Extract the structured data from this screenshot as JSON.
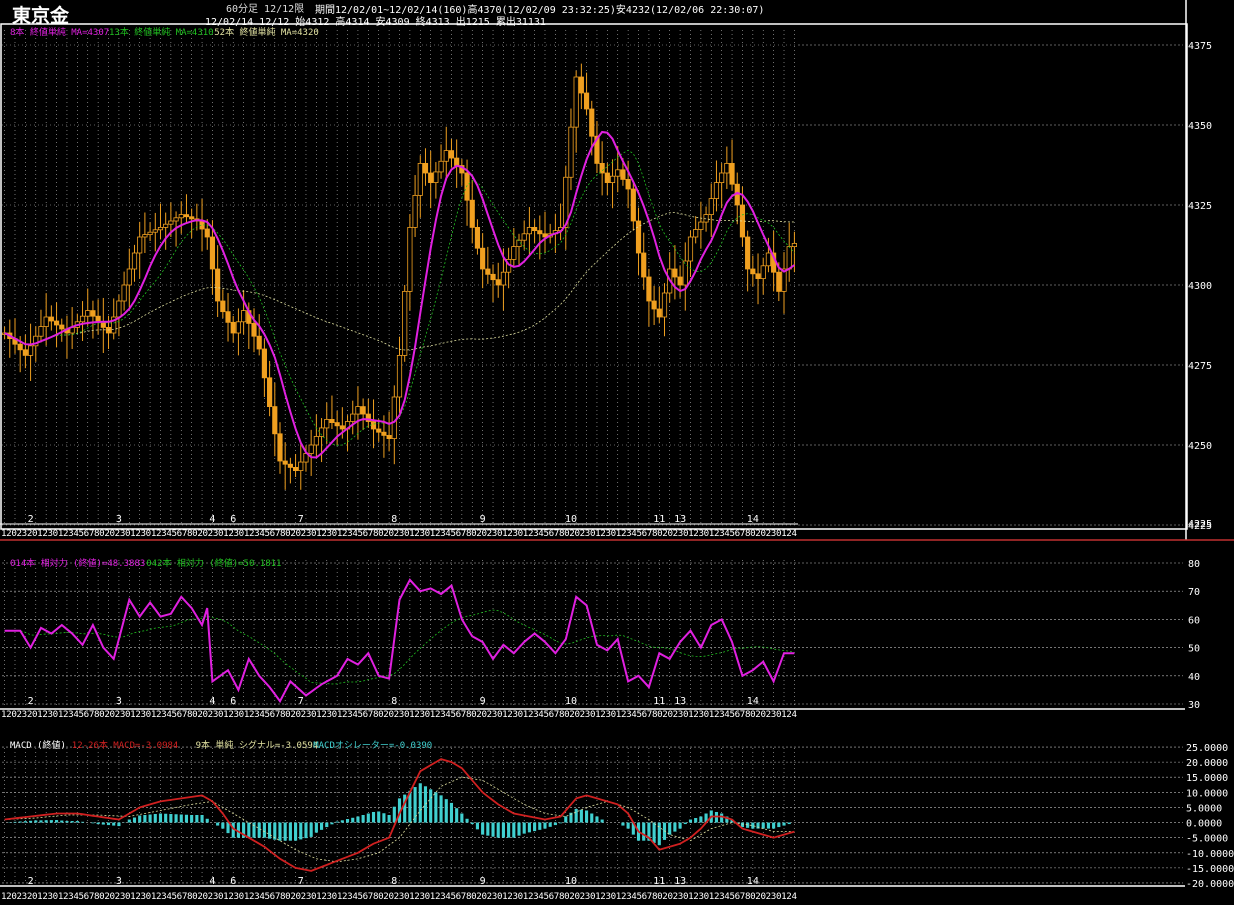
{
  "header": {
    "title": "東京金",
    "period_label": "60分足 12/12限",
    "range_line": "期間12/02/01~12/02/14(160)高4370(12/02/09 23:32:25)安4232(12/02/06 22:30:07)",
    "ohlc_line": "12/02/14 12/12 始4312 高4314 安4309 終4313 出1215 累出31131"
  },
  "colors": {
    "background": "#000000",
    "up_candle": "#f0a020",
    "ma_fast": "#e020e0",
    "ma_mid": "#20c020",
    "ma_slow": "#e0e0a0",
    "macd_line": "#d02020",
    "signal_line": "#e0e0a0",
    "histogram": "#40d0d0",
    "frame": "#ffffff",
    "separator": "#c03030"
  },
  "chart_data": [
    {
      "type": "candlestick",
      "panel": "price",
      "legend": [
        {
          "label": "8本 終値単純 MA=4307",
          "color": "#e020e0"
        },
        {
          "label": "13本 終値単純 MA=4310",
          "color": "#20c020"
        },
        {
          "label": "52本 終値単純 MA=4320",
          "color": "#e0e0a0"
        }
      ],
      "ylim": [
        4225,
        4380
      ],
      "yticks": [
        "4375",
        "4350",
        "4325",
        "4300",
        "4275",
        "4250",
        "4225"
      ],
      "xtick_days": [
        {
          "label": "2",
          "bar": 5
        },
        {
          "label": "3",
          "bar": 22
        },
        {
          "label": "4",
          "bar": 40
        },
        {
          "label": "6",
          "bar": 44
        },
        {
          "label": "7",
          "bar": 57
        },
        {
          "label": "8",
          "bar": 75
        },
        {
          "label": "9",
          "bar": 92
        },
        {
          "label": "10",
          "bar": 109
        },
        {
          "label": "11",
          "bar": 126
        },
        {
          "label": "13",
          "bar": 130
        },
        {
          "label": "14",
          "bar": 144
        }
      ],
      "hour_strip": "1202320123012345678020230123012345678020230123012345678020230123012345678020230123012345678020230123012345678020230123012345678020230123012345678020230124",
      "close_anchors": [
        [
          0,
          4285
        ],
        [
          4,
          4278
        ],
        [
          8,
          4290
        ],
        [
          12,
          4285
        ],
        [
          16,
          4292
        ],
        [
          20,
          4285
        ],
        [
          23,
          4300
        ],
        [
          26,
          4315
        ],
        [
          30,
          4318
        ],
        [
          34,
          4322
        ],
        [
          37,
          4320
        ],
        [
          39,
          4315
        ],
        [
          41,
          4295
        ],
        [
          44,
          4285
        ],
        [
          46,
          4292
        ],
        [
          49,
          4280
        ],
        [
          51,
          4262
        ],
        [
          53,
          4245
        ],
        [
          56,
          4242
        ],
        [
          59,
          4250
        ],
        [
          62,
          4258
        ],
        [
          65,
          4255
        ],
        [
          68,
          4262
        ],
        [
          71,
          4255
        ],
        [
          74,
          4252
        ],
        [
          76,
          4278
        ],
        [
          78,
          4318
        ],
        [
          80,
          4338
        ],
        [
          82,
          4332
        ],
        [
          85,
          4342
        ],
        [
          88,
          4335
        ],
        [
          90,
          4318
        ],
        [
          92,
          4305
        ],
        [
          95,
          4300
        ],
        [
          98,
          4312
        ],
        [
          101,
          4318
        ],
        [
          104,
          4315
        ],
        [
          107,
          4318
        ],
        [
          110,
          4365
        ],
        [
          112,
          4355
        ],
        [
          114,
          4338
        ],
        [
          116,
          4332
        ],
        [
          118,
          4336
        ],
        [
          120,
          4330
        ],
        [
          122,
          4310
        ],
        [
          124,
          4295
        ],
        [
          126,
          4290
        ],
        [
          128,
          4305
        ],
        [
          130,
          4300
        ],
        [
          132,
          4315
        ],
        [
          135,
          4322
        ],
        [
          137,
          4332
        ],
        [
          139,
          4338
        ],
        [
          141,
          4325
        ],
        [
          143,
          4305
        ],
        [
          145,
          4302
        ],
        [
          147,
          4310
        ],
        [
          149,
          4298
        ],
        [
          151,
          4312
        ],
        [
          152,
          4313
        ]
      ]
    },
    {
      "type": "line",
      "panel": "rsi",
      "legend": [
        {
          "label": "014本 相対力 (終値)=48.3883",
          "color": "#e020e0"
        },
        {
          "label": "042本 相対力 (終値)=50.1811",
          "color": "#20c020"
        }
      ],
      "ylim": [
        30,
        80
      ],
      "yticks": [
        "80",
        "70",
        "60",
        "50",
        "40",
        "30"
      ],
      "anchors": [
        [
          0,
          56
        ],
        [
          3,
          56
        ],
        [
          5,
          50
        ],
        [
          7,
          57
        ],
        [
          9,
          55
        ],
        [
          11,
          58
        ],
        [
          13,
          55
        ],
        [
          15,
          51
        ],
        [
          17,
          58
        ],
        [
          19,
          50
        ],
        [
          21,
          46
        ],
        [
          24,
          67
        ],
        [
          26,
          61
        ],
        [
          28,
          66
        ],
        [
          30,
          61
        ],
        [
          32,
          62
        ],
        [
          34,
          68
        ],
        [
          36,
          64
        ],
        [
          38,
          58
        ],
        [
          39,
          64
        ],
        [
          40,
          38
        ],
        [
          43,
          42
        ],
        [
          45,
          35
        ],
        [
          47,
          46
        ],
        [
          49,
          40
        ],
        [
          51,
          36
        ],
        [
          53,
          31
        ],
        [
          55,
          38
        ],
        [
          58,
          33
        ],
        [
          61,
          37
        ],
        [
          64,
          40
        ],
        [
          66,
          46
        ],
        [
          68,
          44
        ],
        [
          70,
          48
        ],
        [
          72,
          40
        ],
        [
          74,
          39
        ],
        [
          76,
          67
        ],
        [
          78,
          74
        ],
        [
          80,
          70
        ],
        [
          82,
          71
        ],
        [
          84,
          69
        ],
        [
          86,
          72
        ],
        [
          88,
          60
        ],
        [
          90,
          54
        ],
        [
          92,
          52
        ],
        [
          94,
          46
        ],
        [
          96,
          51
        ],
        [
          98,
          48
        ],
        [
          100,
          52
        ],
        [
          102,
          55
        ],
        [
          104,
          52
        ],
        [
          106,
          48
        ],
        [
          108,
          53
        ],
        [
          110,
          68
        ],
        [
          112,
          65
        ],
        [
          114,
          51
        ],
        [
          116,
          49
        ],
        [
          118,
          53
        ],
        [
          120,
          38
        ],
        [
          122,
          40
        ],
        [
          124,
          36
        ],
        [
          126,
          48
        ],
        [
          128,
          46
        ],
        [
          130,
          52
        ],
        [
          132,
          56
        ],
        [
          134,
          50
        ],
        [
          136,
          58
        ],
        [
          138,
          60
        ],
        [
          140,
          52
        ],
        [
          142,
          40
        ],
        [
          144,
          42
        ],
        [
          146,
          45
        ],
        [
          148,
          38
        ],
        [
          150,
          48
        ],
        [
          152,
          48
        ]
      ]
    },
    {
      "type": "bar+line",
      "panel": "macd",
      "legend": [
        {
          "label": "MACD (終値)",
          "color": "#ffffff"
        },
        {
          "label": "12-26本 MACD=-3.0984",
          "color": "#d02020"
        },
        {
          "label": "9本 単純 シグナル=-3.0594",
          "color": "#e0e0a0"
        },
        {
          "label": "MACDオシレーター=-0.0390",
          "color": "#40d0d0"
        }
      ],
      "ylim": [
        -21,
        26
      ],
      "yticks": [
        "25.0000",
        "20.0000",
        "15.0000",
        "10.0000",
        "5.0000",
        "0.0000",
        "-5.0000",
        "-10.0000",
        "-15.0000",
        "-20.0000"
      ],
      "macd_anchors": [
        [
          0,
          1
        ],
        [
          5,
          2
        ],
        [
          10,
          3
        ],
        [
          14,
          3
        ],
        [
          18,
          2
        ],
        [
          22,
          1
        ],
        [
          26,
          5
        ],
        [
          30,
          7
        ],
        [
          34,
          8
        ],
        [
          38,
          9
        ],
        [
          40,
          7
        ],
        [
          42,
          3
        ],
        [
          44,
          -2
        ],
        [
          47,
          -5
        ],
        [
          50,
          -8
        ],
        [
          53,
          -12
        ],
        [
          56,
          -15
        ],
        [
          59,
          -16
        ],
        [
          62,
          -14
        ],
        [
          65,
          -12
        ],
        [
          68,
          -10
        ],
        [
          71,
          -7
        ],
        [
          74,
          -5
        ],
        [
          76,
          3
        ],
        [
          78,
          10
        ],
        [
          80,
          17
        ],
        [
          82,
          19
        ],
        [
          84,
          21
        ],
        [
          86,
          20
        ],
        [
          88,
          18
        ],
        [
          90,
          14
        ],
        [
          92,
          10
        ],
        [
          95,
          6
        ],
        [
          98,
          3
        ],
        [
          101,
          2
        ],
        [
          104,
          1
        ],
        [
          107,
          2
        ],
        [
          110,
          8
        ],
        [
          112,
          9
        ],
        [
          114,
          8
        ],
        [
          116,
          7
        ],
        [
          118,
          6
        ],
        [
          120,
          3
        ],
        [
          122,
          -3
        ],
        [
          124,
          -5
        ],
        [
          126,
          -9
        ],
        [
          128,
          -8
        ],
        [
          130,
          -7
        ],
        [
          132,
          -5
        ],
        [
          134,
          -2
        ],
        [
          136,
          2
        ],
        [
          138,
          2
        ],
        [
          140,
          1
        ],
        [
          142,
          -2
        ],
        [
          144,
          -3
        ],
        [
          146,
          -4
        ],
        [
          148,
          -5
        ],
        [
          150,
          -4
        ],
        [
          152,
          -3
        ]
      ],
      "signal_anchors": [
        [
          0,
          1
        ],
        [
          6,
          1.5
        ],
        [
          12,
          2.5
        ],
        [
          18,
          2.5
        ],
        [
          24,
          2
        ],
        [
          30,
          4
        ],
        [
          36,
          6
        ],
        [
          40,
          7
        ],
        [
          44,
          3
        ],
        [
          48,
          -1
        ],
        [
          52,
          -5
        ],
        [
          56,
          -9
        ],
        [
          60,
          -12
        ],
        [
          64,
          -13
        ],
        [
          68,
          -12
        ],
        [
          72,
          -10
        ],
        [
          76,
          -5
        ],
        [
          80,
          4
        ],
        [
          84,
          12
        ],
        [
          88,
          15
        ],
        [
          92,
          14
        ],
        [
          96,
          10
        ],
        [
          100,
          6
        ],
        [
          104,
          3
        ],
        [
          108,
          2
        ],
        [
          112,
          5
        ],
        [
          116,
          7
        ],
        [
          120,
          5
        ],
        [
          124,
          1
        ],
        [
          128,
          -4
        ],
        [
          132,
          -6
        ],
        [
          136,
          -2
        ],
        [
          140,
          0
        ],
        [
          144,
          -1
        ],
        [
          148,
          -3
        ],
        [
          152,
          -3
        ]
      ]
    }
  ]
}
